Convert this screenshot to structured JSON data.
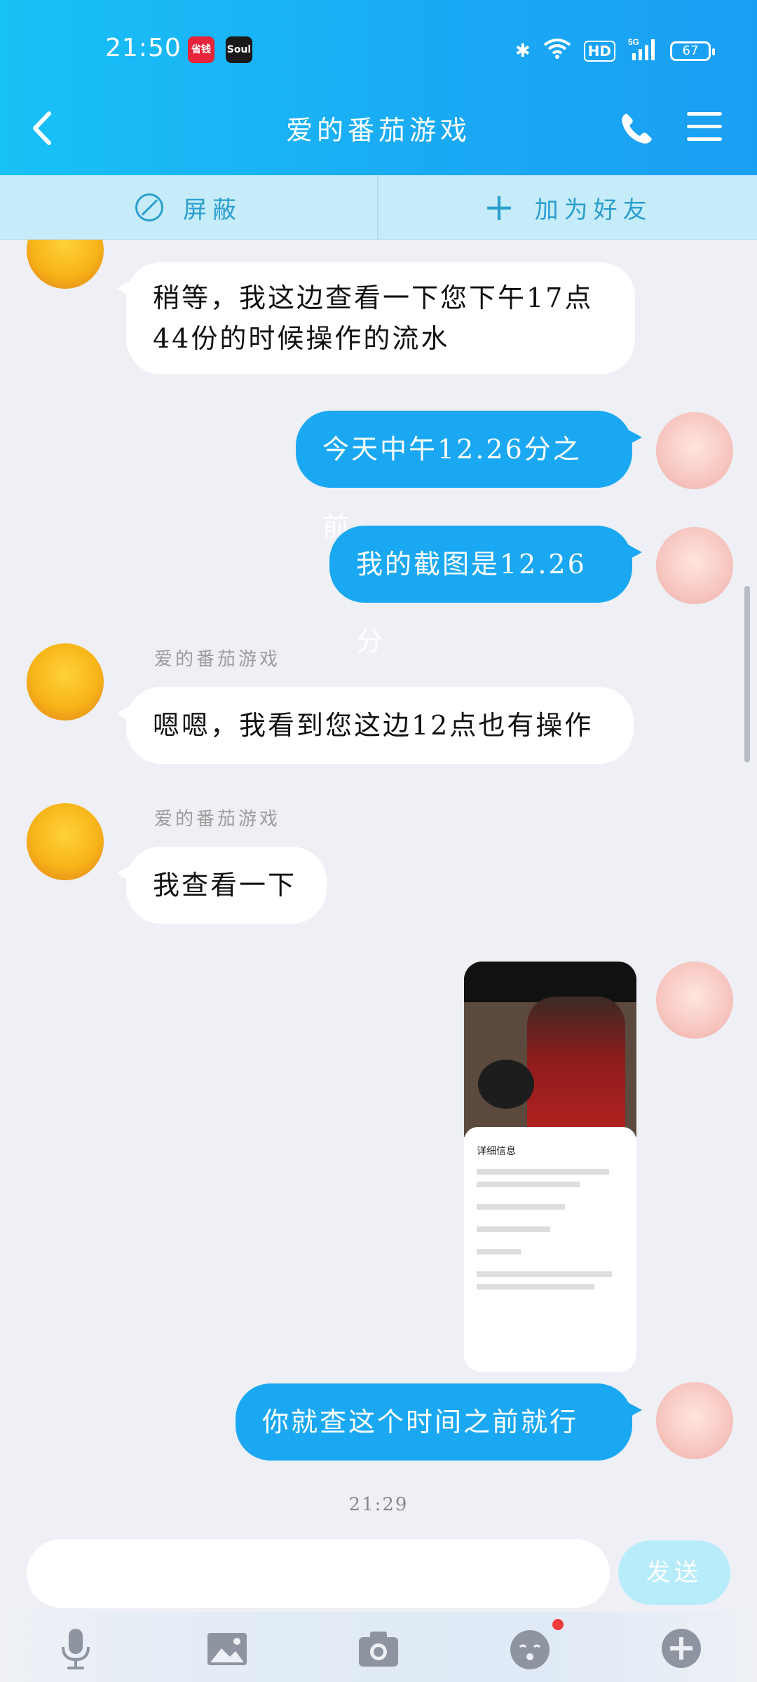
{
  "status_bar": {
    "time": "21:50",
    "app1": "省钱",
    "app2": "Soul",
    "hd": "HD",
    "network": "5G",
    "battery": "67"
  },
  "header": {
    "title": "爱的番茄游戏"
  },
  "action_bar": {
    "block_label": "屏蔽",
    "add_friend_label": "加为好友"
  },
  "messages": [
    {
      "side": "left",
      "sender": "",
      "text_line1": "稍等，我这边查看一下您下午17点",
      "text_line2": "44份的时候操作的流水"
    },
    {
      "side": "right",
      "text": "今天中午12.26分之前"
    },
    {
      "side": "right",
      "text": "我的截图是12.26分"
    },
    {
      "side": "left",
      "sender": "爱的番茄游戏",
      "text": "嗯嗯，我看到您这边12点也有操作"
    },
    {
      "side": "left",
      "sender": "爱的番茄游戏",
      "text": "我查看一下"
    },
    {
      "side": "right",
      "type": "image",
      "detail_title": "详细信息"
    },
    {
      "side": "right",
      "text": "你就查这个时间之前就行"
    }
  ],
  "timestamp": "21:29",
  "input": {
    "placeholder": "",
    "send_label": "发送"
  },
  "toolbar": {
    "icons": [
      "microphone-icon",
      "image-icon",
      "camera-icon",
      "emoji-icon",
      "plus-icon"
    ]
  },
  "colors": {
    "header": "#1aa9f4",
    "bubble_right": "#1ba8f3",
    "bubble_left": "#ffffff",
    "action_bar": "#c7ecf9",
    "send_button": "#b9ecfb"
  }
}
